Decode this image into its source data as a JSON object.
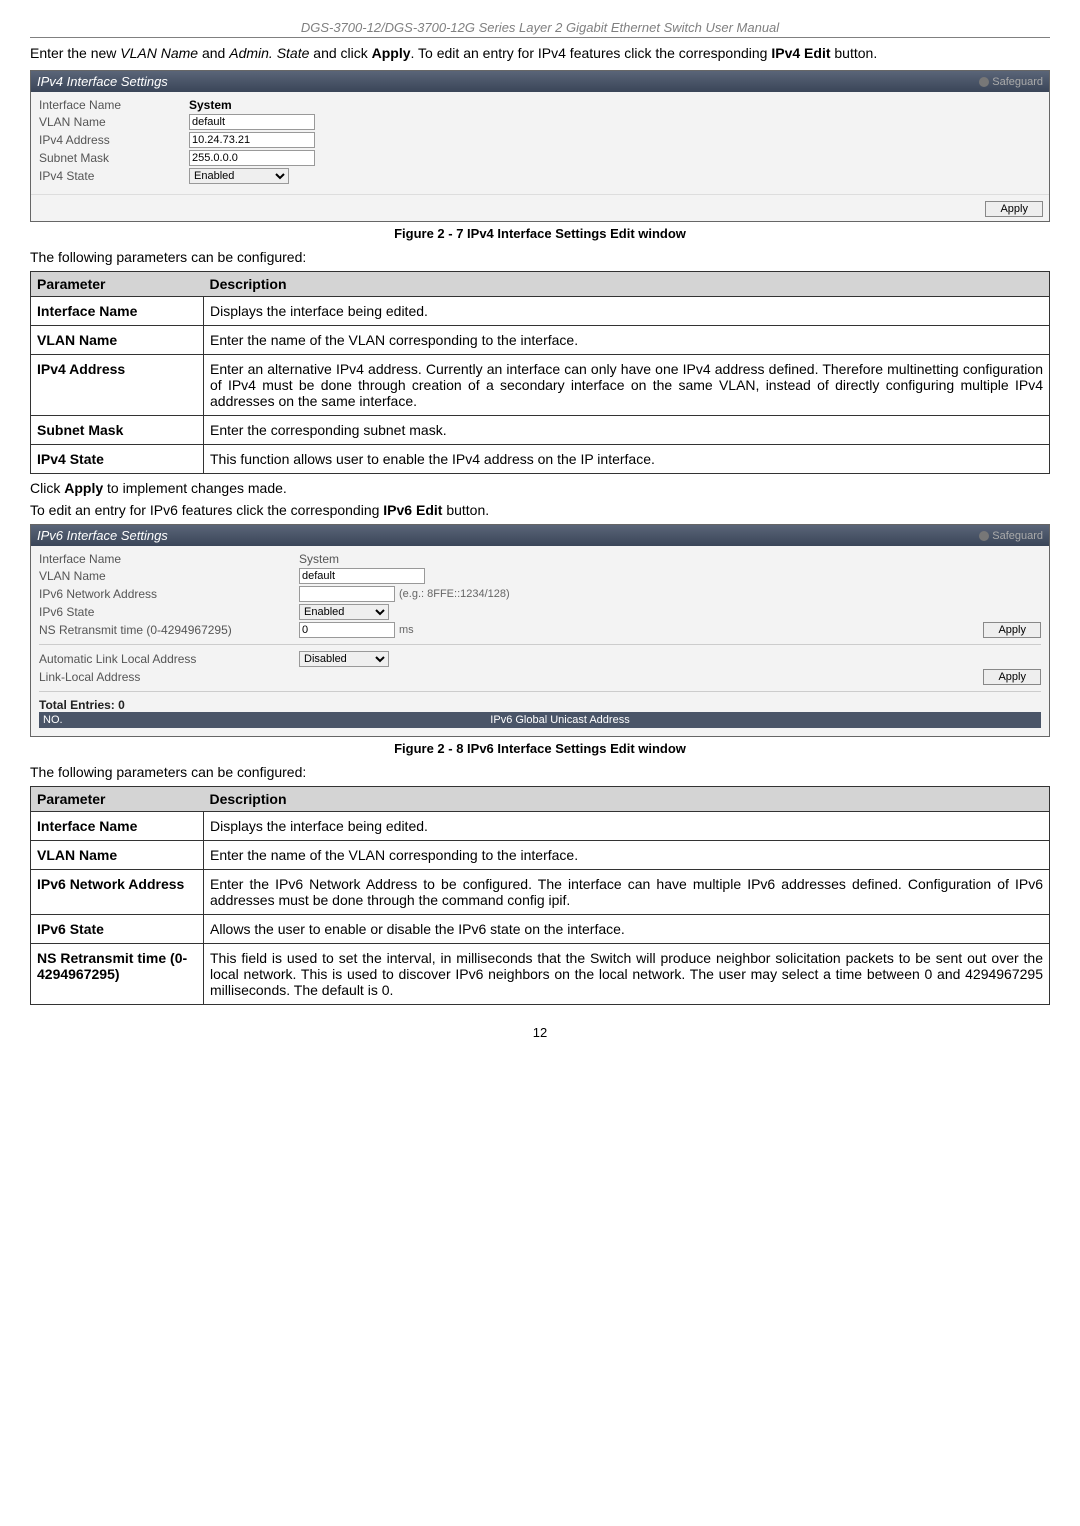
{
  "header": "DGS-3700-12/DGS-3700-12G Series Layer 2 Gigabit Ethernet Switch User Manual",
  "intro": {
    "t1": "Enter the new ",
    "t2": "VLAN Name",
    "t3": " and ",
    "t4": "Admin. State",
    "t5": " and click ",
    "t6": "Apply",
    "t7": ". To edit an entry for IPv4 features click the corresponding ",
    "t8": "IPv4 Edit",
    "t9": " button."
  },
  "ipv4panel": {
    "title": "IPv4 Interface Settings",
    "safeguard": "Safeguard",
    "rows": {
      "iface_lbl": "Interface Name",
      "iface_val": "System",
      "vlan_lbl": "VLAN Name",
      "vlan_val": "default",
      "ipv4_lbl": "IPv4 Address",
      "ipv4_val": "10.24.73.21",
      "mask_lbl": "Subnet Mask",
      "mask_val": "255.0.0.0",
      "state_lbl": "IPv4 State",
      "state_val": "Enabled"
    },
    "apply": "Apply"
  },
  "caption1": "Figure 2 - 7 IPv4 Interface Settings Edit window",
  "para1": "The following parameters can be configured:",
  "table_hdr_param": "Parameter",
  "table_hdr_desc": "Description",
  "t4": [
    {
      "p": "Interface Name",
      "d": "Displays the interface being edited."
    },
    {
      "p": "VLAN Name",
      "d": "Enter the name of the VLAN corresponding to the interface."
    },
    {
      "p": "IPv4 Address",
      "d": "Enter an alternative IPv4 address. Currently an interface can only have one IPv4 address defined. Therefore multinetting configuration of IPv4 must be done through creation of a secondary interface on the same VLAN, instead of directly configuring multiple IPv4 addresses on the same interface."
    },
    {
      "p": "Subnet Mask",
      "d": "Enter the corresponding subnet mask."
    },
    {
      "p": "IPv4 State",
      "d": "This function allows user to enable the IPv4 address on the IP interface."
    }
  ],
  "para2a": "Click ",
  "para2b": "Apply",
  "para2c": " to implement changes made.",
  "para3a": "To edit an entry for IPv6 features click the corresponding ",
  "para3b": "IPv6 Edit",
  "para3c": " button.",
  "ipv6panel": {
    "title": "IPv6 Interface Settings",
    "safeguard": "Safeguard",
    "rows": {
      "iface_lbl": "Interface Name",
      "iface_val": "System",
      "vlan_lbl": "VLAN Name",
      "vlan_val": "default",
      "net_lbl": "IPv6 Network Address",
      "net_val": "",
      "net_hint": "(e.g.: 8FFE::1234/128)",
      "state_lbl": "IPv6 State",
      "state_val": "Enabled",
      "ns_lbl": "NS Retransmit time (0-4294967295)",
      "ns_val": "0",
      "ns_unit": "ms",
      "auto_lbl": "Automatic Link Local Address",
      "auto_val": "Disabled",
      "ll_lbl": "Link-Local Address"
    },
    "apply": "Apply",
    "total": "Total Entries: 0",
    "col_no": "NO.",
    "col_addr": "IPv6 Global Unicast Address"
  },
  "caption2": "Figure 2 - 8 IPv6 Interface Settings Edit window",
  "para4": "The following parameters can be configured:",
  "t6": [
    {
      "p": "Interface Name",
      "d": "Displays the interface being edited."
    },
    {
      "p": "VLAN Name",
      "d": "Enter the name of the VLAN corresponding to the interface."
    },
    {
      "p": "IPv6 Network Address",
      "d": "Enter the IPv6 Network Address to be configured. The interface can have multiple IPv6 addresses defined. Configuration of IPv6 addresses must be done through the command config ipif."
    },
    {
      "p": "IPv6 State",
      "d": "Allows the user to enable or disable the IPv6 state on the interface."
    },
    {
      "p": "NS Retransmit time (0-4294967295)",
      "d": "This field is used to set the interval, in milliseconds that the Switch will produce neighbor solicitation packets to be sent out over the local network. This is used to discover IPv6 neighbors on the local network. The user may select a time between 0 and 4294967295 milliseconds. The default is 0."
    }
  ],
  "page_no": "12"
}
